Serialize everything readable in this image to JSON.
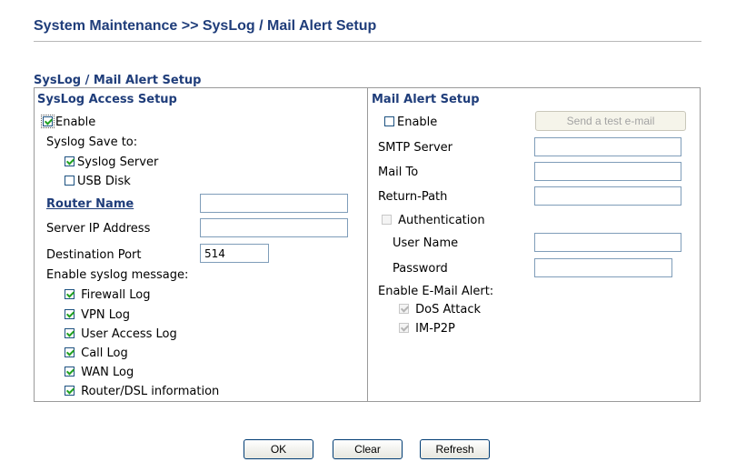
{
  "page": {
    "title": "System Maintenance >> SysLog / Mail Alert Setup",
    "section_title": "SysLog / Mail Alert Setup"
  },
  "syslog": {
    "header": "SysLog Access Setup",
    "enable_label": "Enable",
    "save_to_label": "Syslog Save to:",
    "syslog_server_label": "Syslog Server",
    "usb_disk_label": "USB Disk",
    "router_name_label": "Router Name",
    "router_name_value": "",
    "server_ip_label": "Server IP Address",
    "server_ip_value": "",
    "dest_port_label": "Destination Port",
    "dest_port_value": "514",
    "messages_label": "Enable syslog message:",
    "messages": [
      "Firewall Log",
      "VPN Log",
      "User Access Log",
      "Call Log",
      "WAN Log",
      "Router/DSL information"
    ]
  },
  "mail": {
    "header": "Mail Alert Setup",
    "enable_label": "Enable",
    "test_button": "Send a test e-mail",
    "smtp_label": "SMTP Server",
    "smtp_value": "",
    "mail_to_label": "Mail To",
    "mail_to_value": "",
    "return_path_label": "Return-Path",
    "return_path_value": "",
    "auth_label": "Authentication",
    "user_name_label": "User Name",
    "user_name_value": "",
    "password_label": "Password",
    "password_value": "",
    "alert_label": "Enable E-Mail Alert:",
    "dos_label": "DoS Attack",
    "im_label": "IM-P2P"
  },
  "buttons": {
    "ok": "OK",
    "clear": "Clear",
    "refresh": "Refresh"
  }
}
